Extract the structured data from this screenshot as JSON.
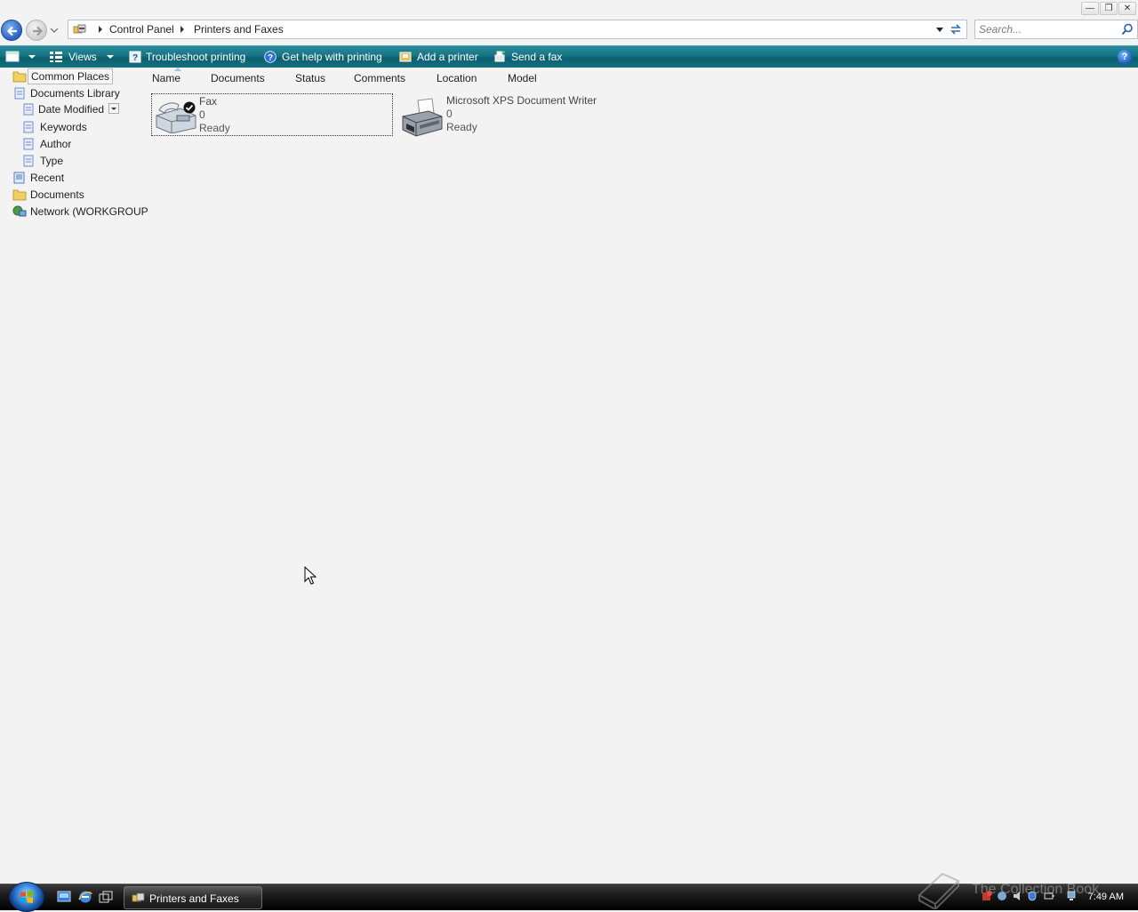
{
  "window": {
    "minimize_label": "minimize",
    "restore_label": "restore",
    "close_label": "close"
  },
  "address": {
    "crumbs": [
      "Control Panel",
      "Printers and Faxes"
    ],
    "search_placeholder": "Search..."
  },
  "toolbar": {
    "views_label": "Views",
    "troubleshoot_label": "Troubleshoot printing",
    "get_help_label": "Get help with printing",
    "add_printer_label": "Add a printer",
    "send_fax_label": "Send a fax",
    "help_glyph": "?"
  },
  "nav": {
    "common_places": "Common Places",
    "documents_library": "Documents Library",
    "date_modified": "Date Modified",
    "keywords": "Keywords",
    "author": "Author",
    "type": "Type",
    "recent": "Recent",
    "documents": "Documents",
    "network": "Network (WORKGROUP"
  },
  "columns": [
    "Name",
    "Documents",
    "Status",
    "Comments",
    "Location",
    "Model"
  ],
  "printers": [
    {
      "name": "Fax",
      "documents": "0",
      "status": "Ready",
      "icon": "fax-icon",
      "default": true
    },
    {
      "name": "Microsoft XPS Document Writer",
      "documents": "0",
      "status": "Ready",
      "icon": "printer-icon",
      "default": false
    }
  ],
  "taskbar": {
    "task_label": "Printers and Faxes",
    "clock": "7:49 AM",
    "watermark": "The Collection Book"
  },
  "colors": {
    "command_bar": "#167484",
    "background": "#f3f3f3",
    "taskbar": "#1b1b1b"
  }
}
